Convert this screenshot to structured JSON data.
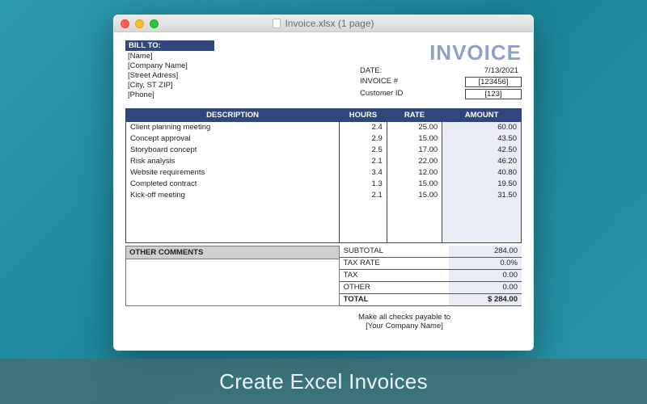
{
  "caption": "Create Excel Invoices",
  "window": {
    "title": "Invoice.xlsx (1 page)"
  },
  "billto": {
    "header": "BILL TO:",
    "fields": [
      "[Name]",
      "[Company Name]",
      "[Street Adress]",
      "[City, ST  ZIP]",
      "[Phone]"
    ]
  },
  "heading": "INVOICE",
  "meta": {
    "date_label": "DATE:",
    "date_value": "7/13/2021",
    "invno_label": "INVOICE #",
    "invno_value": "[123456]",
    "cust_label": "Customer ID",
    "cust_value": "[123]"
  },
  "table": {
    "headers": {
      "desc": "DESCRIPTION",
      "hours": "HOURS",
      "rate": "RATE",
      "amount": "AMOUNT"
    },
    "rows": [
      {
        "desc": "Client planning meeting",
        "hours": "2.4",
        "rate": "25.00",
        "amount": "60.00"
      },
      {
        "desc": "Concept approval",
        "hours": "2.9",
        "rate": "15.00",
        "amount": "43.50"
      },
      {
        "desc": "Storyboard concept",
        "hours": "2.5",
        "rate": "17.00",
        "amount": "42.50"
      },
      {
        "desc": "Risk analysis",
        "hours": "2.1",
        "rate": "22.00",
        "amount": "46.20"
      },
      {
        "desc": "Website requirements",
        "hours": "3.4",
        "rate": "12.00",
        "amount": "40.80"
      },
      {
        "desc": "Completed contract",
        "hours": "1.3",
        "rate": "15.00",
        "amount": "19.50"
      },
      {
        "desc": "Kick-off meeting",
        "hours": "2.1",
        "rate": "15.00",
        "amount": "31.50"
      }
    ]
  },
  "comments_header": "OTHER COMMENTS",
  "summary": {
    "subtotal_label": "SUBTOTAL",
    "subtotal": "284.00",
    "taxrate_label": "TAX RATE",
    "taxrate": "0.0%",
    "tax_label": "TAX",
    "tax": "0.00",
    "other_label": "OTHER",
    "other": "0.00",
    "total_label": "TOTAL",
    "total": "$ 284.00"
  },
  "payable": {
    "line1": "Make all checks payable to",
    "line2": "[Your Company Name]"
  }
}
